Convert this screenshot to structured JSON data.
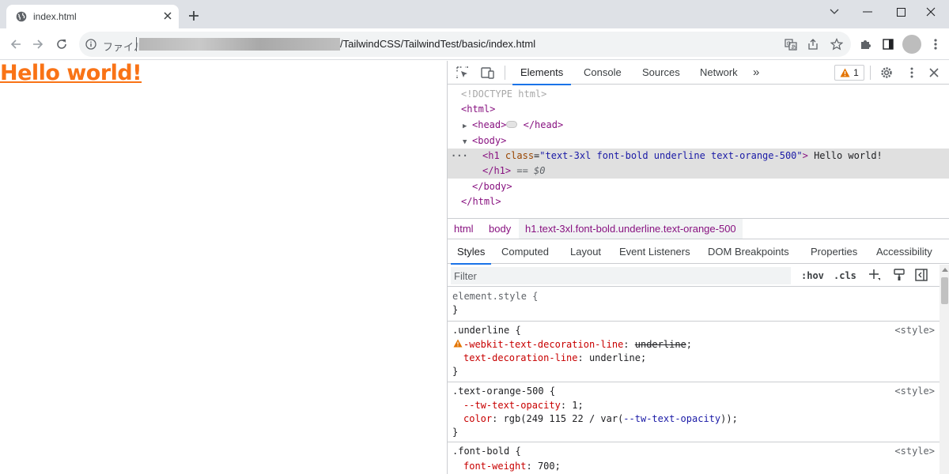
{
  "browser": {
    "tab_title": "index.html",
    "omnibox": {
      "scheme_label": "ファイル",
      "path_visible": "/TailwindCSS/TailwindTest/basic/index.html"
    }
  },
  "page": {
    "heading": "Hello world!",
    "heading_color": "#f97316"
  },
  "devtools": {
    "tabs": [
      "Elements",
      "Console",
      "Sources",
      "Network"
    ],
    "more_tabs": "»",
    "warning_count": "1",
    "dom": {
      "doctype": "<!DOCTYPE html>",
      "html_open": "<html>",
      "head_open": "<head>",
      "head_close": "</head>",
      "body_open": "<body>",
      "h1_tag_open": "<h1",
      "h1_attr_name": "class",
      "h1_attr_value": "\"text-3xl font-bold underline text-orange-500\"",
      "h1_bracket": ">",
      "h1_text": " Hello world!",
      "h1_close": "</h1>",
      "h1_marker": " == $0",
      "body_close": "</body>",
      "html_close": "</html>"
    },
    "breadcrumbs": [
      "html",
      "body",
      "h1.text-3xl.font-bold.underline.text-orange-500"
    ],
    "subtabs": [
      "Styles",
      "Computed",
      "Layout",
      "Event Listeners",
      "DOM Breakpoints",
      "Properties",
      "Accessibility"
    ],
    "filter_placeholder": "Filter",
    "hov": ":hov",
    "cls": ".cls",
    "rules": {
      "element_style": {
        "selector": "element.style {",
        "close": "}"
      },
      "underline": {
        "selector": ".underline {",
        "source": "<style>",
        "p1_name": "-webkit-text-decoration-line",
        "p1_value": "underline",
        "p2_name": "text-decoration-line",
        "p2_value": "underline",
        "close": "}"
      },
      "orange": {
        "selector": ".text-orange-500 {",
        "source": "<style>",
        "p1_name": "--tw-text-opacity",
        "p1_value": "1",
        "p2_name": "color",
        "p2_value_a": "rgb(249 115 22 / var(",
        "p2_value_var": "--tw-text-opacity",
        "p2_value_b": "));",
        "close": "}"
      },
      "bold": {
        "selector": ".font-bold {",
        "source": "<style>",
        "p1_name": "font-weight",
        "p1_value": "700"
      }
    }
  }
}
